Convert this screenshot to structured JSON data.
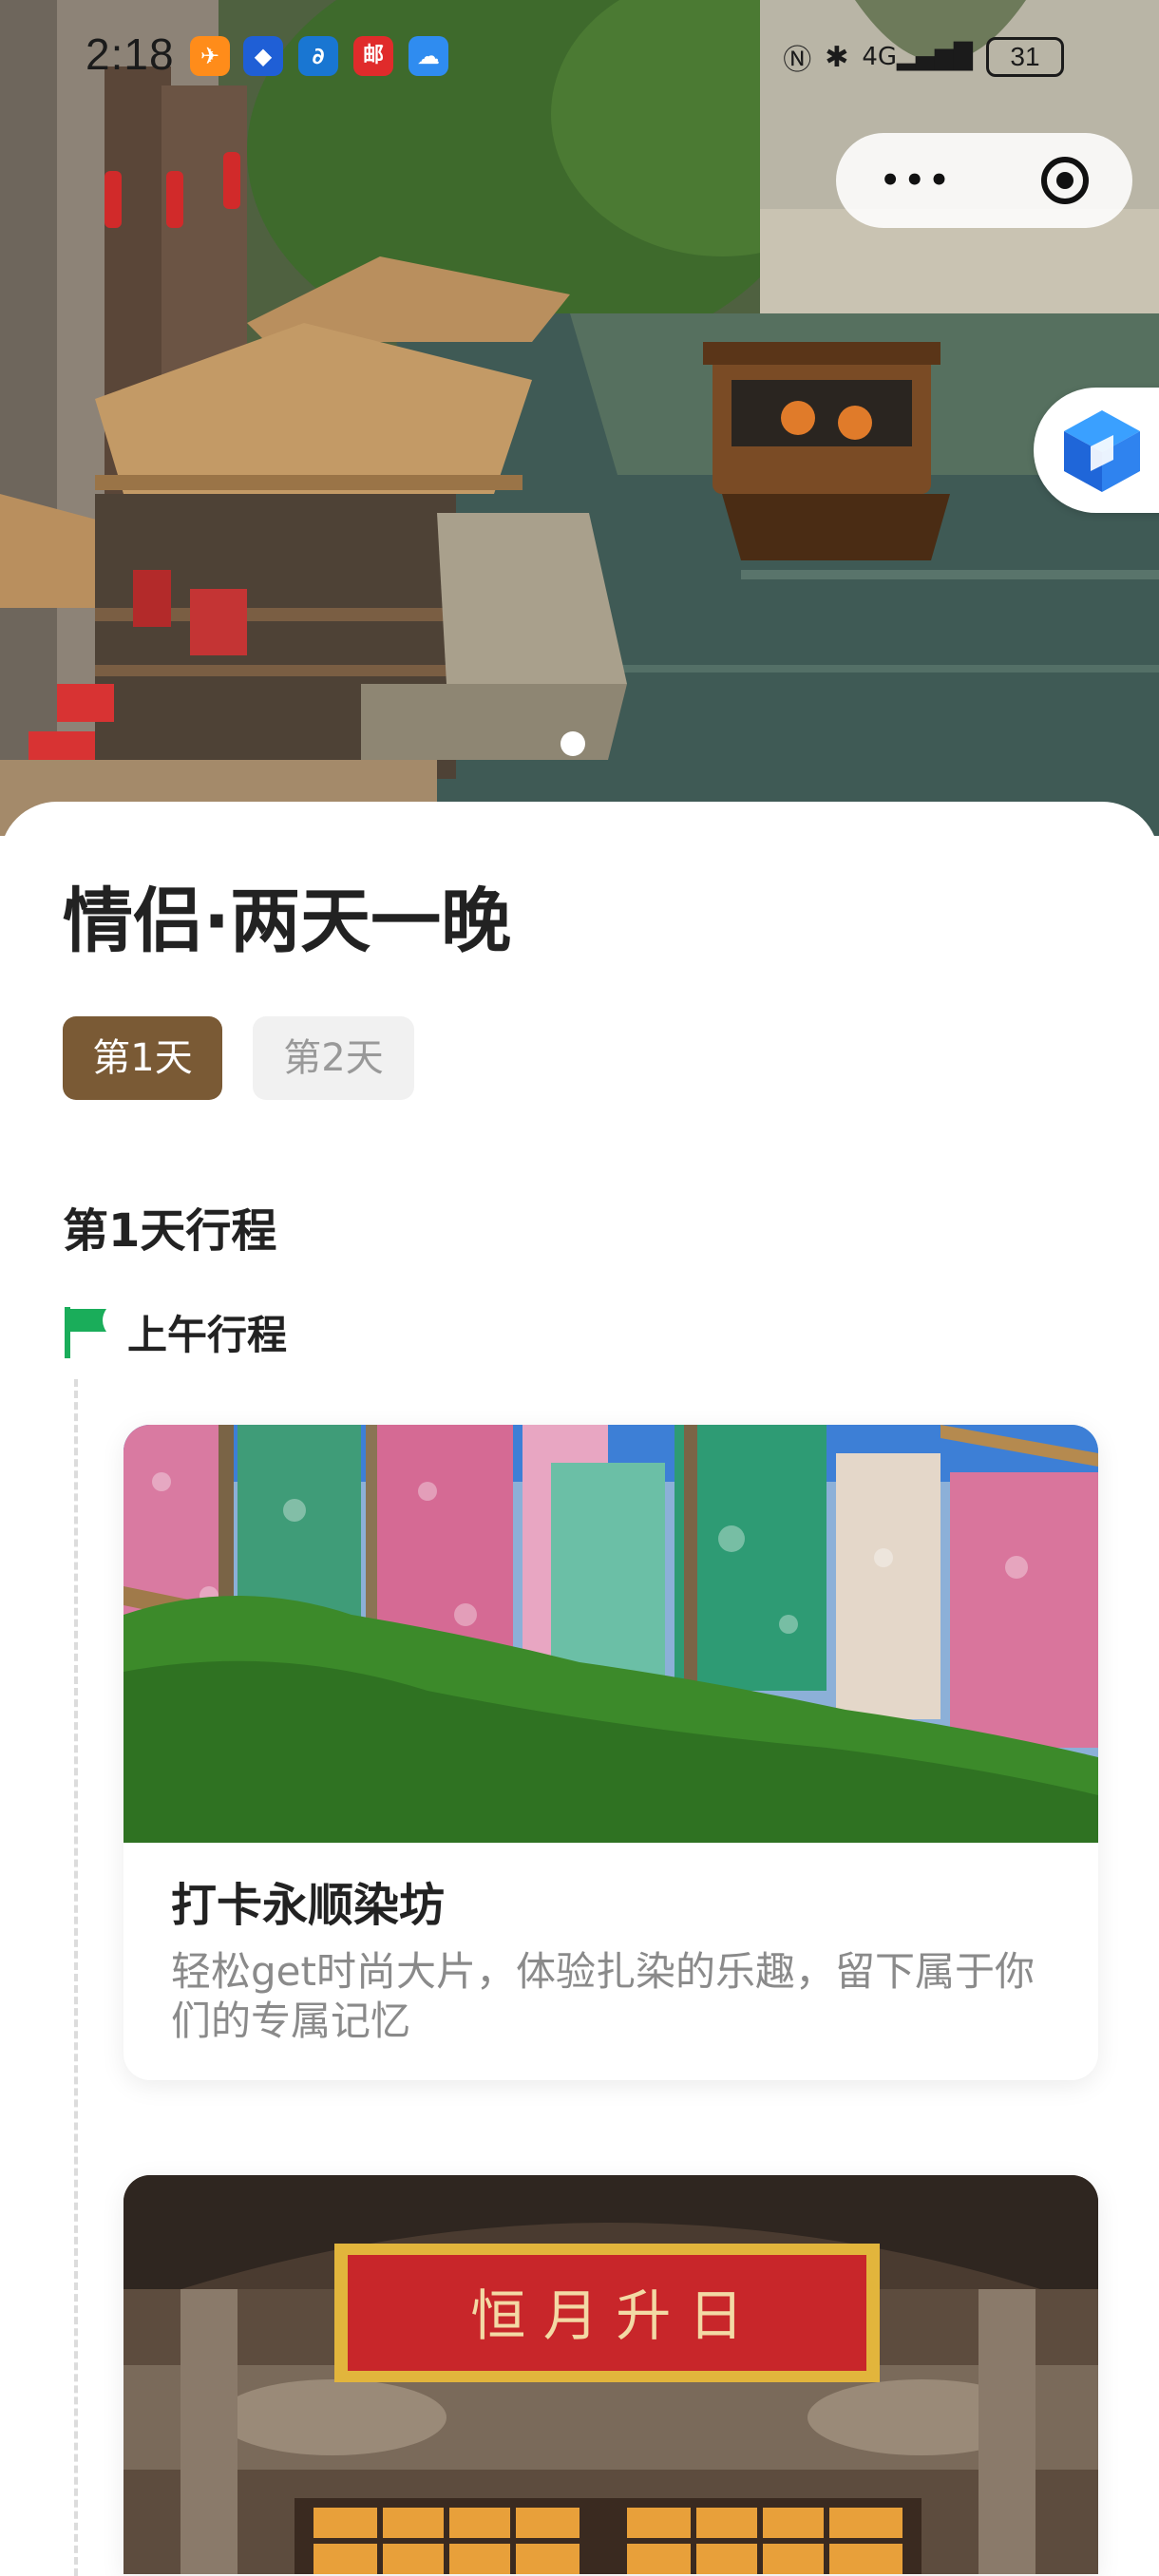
{
  "status_bar": {
    "time": "2:18",
    "battery": "31",
    "app_icons": [
      {
        "icon": "fliggy-app-icon",
        "color": "#ff8c1a",
        "glyph": "✈"
      },
      {
        "icon": "trip-app-icon",
        "color": "#1f5fd6",
        "glyph": "◆"
      },
      {
        "icon": "swirl-app-icon",
        "color": "#1976d2",
        "glyph": "∂"
      },
      {
        "icon": "mail-app-icon",
        "color": "#e02b2b",
        "glyph": "邮"
      },
      {
        "icon": "cloud-app-icon",
        "color": "#2f8cf0",
        "glyph": "☁"
      }
    ],
    "sys_icons": [
      "nfc-icon",
      "bluetooth-icon",
      "4g-signal-icon"
    ]
  },
  "capsule": {
    "more_label": "•••"
  },
  "page": {
    "title": "情侣·两天一晚",
    "tabs": [
      {
        "label": "第1天",
        "active": true
      },
      {
        "label": "第2天",
        "active": false
      }
    ],
    "section_title": "第1天行程",
    "period_label": "上午行程",
    "cards": [
      {
        "title": "打卡永顺染坊",
        "desc": "轻松get时尚大片，体验扎染的乐趣，留下属于你们的专属记忆"
      },
      {
        "plaque_text": "恒 月 升 日"
      }
    ]
  },
  "colors": {
    "accent": "#7a5a35",
    "flag": "#1aad5a",
    "plaque_red": "#c8262a",
    "plaque_gold": "#e2b53c"
  }
}
